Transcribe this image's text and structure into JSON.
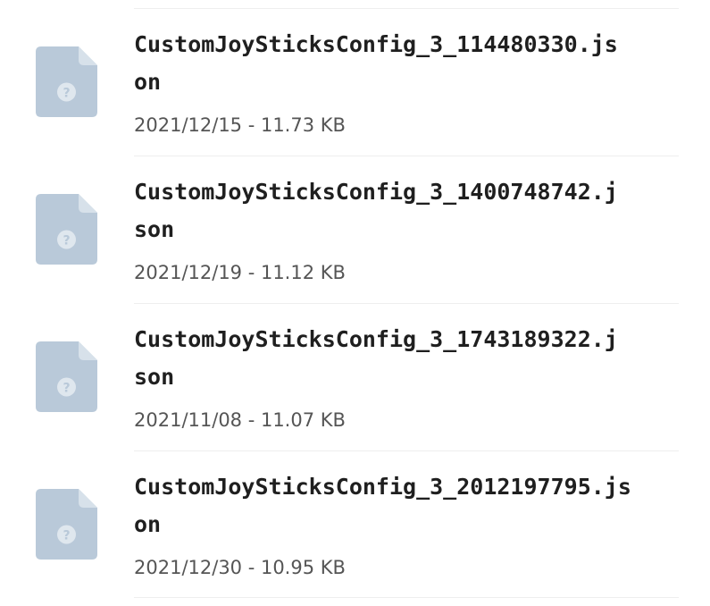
{
  "colors": {
    "icon_fill": "#b9c9d9",
    "icon_fold": "#d7e1ea",
    "name_text": "#1f1f1f",
    "meta_text": "#555555",
    "divider": "#eeeeee"
  },
  "files": [
    {
      "name_line1": "CustomJoySticksConfig_3_114480330.js",
      "name_line2": "on",
      "meta": "2021/12/15 - 11.73 KB",
      "icon": "unknown-file-icon"
    },
    {
      "name_line1": "CustomJoySticksConfig_3_1400748742.j",
      "name_line2": "son",
      "meta": "2021/12/19 - 11.12 KB",
      "icon": "unknown-file-icon"
    },
    {
      "name_line1": "CustomJoySticksConfig_3_1743189322.j",
      "name_line2": "son",
      "meta": "2021/11/08 - 11.07 KB",
      "icon": "unknown-file-icon"
    },
    {
      "name_line1": "CustomJoySticksConfig_3_2012197795.js",
      "name_line2": "on",
      "meta": "2021/12/30 - 10.95 KB",
      "icon": "unknown-file-icon"
    }
  ]
}
